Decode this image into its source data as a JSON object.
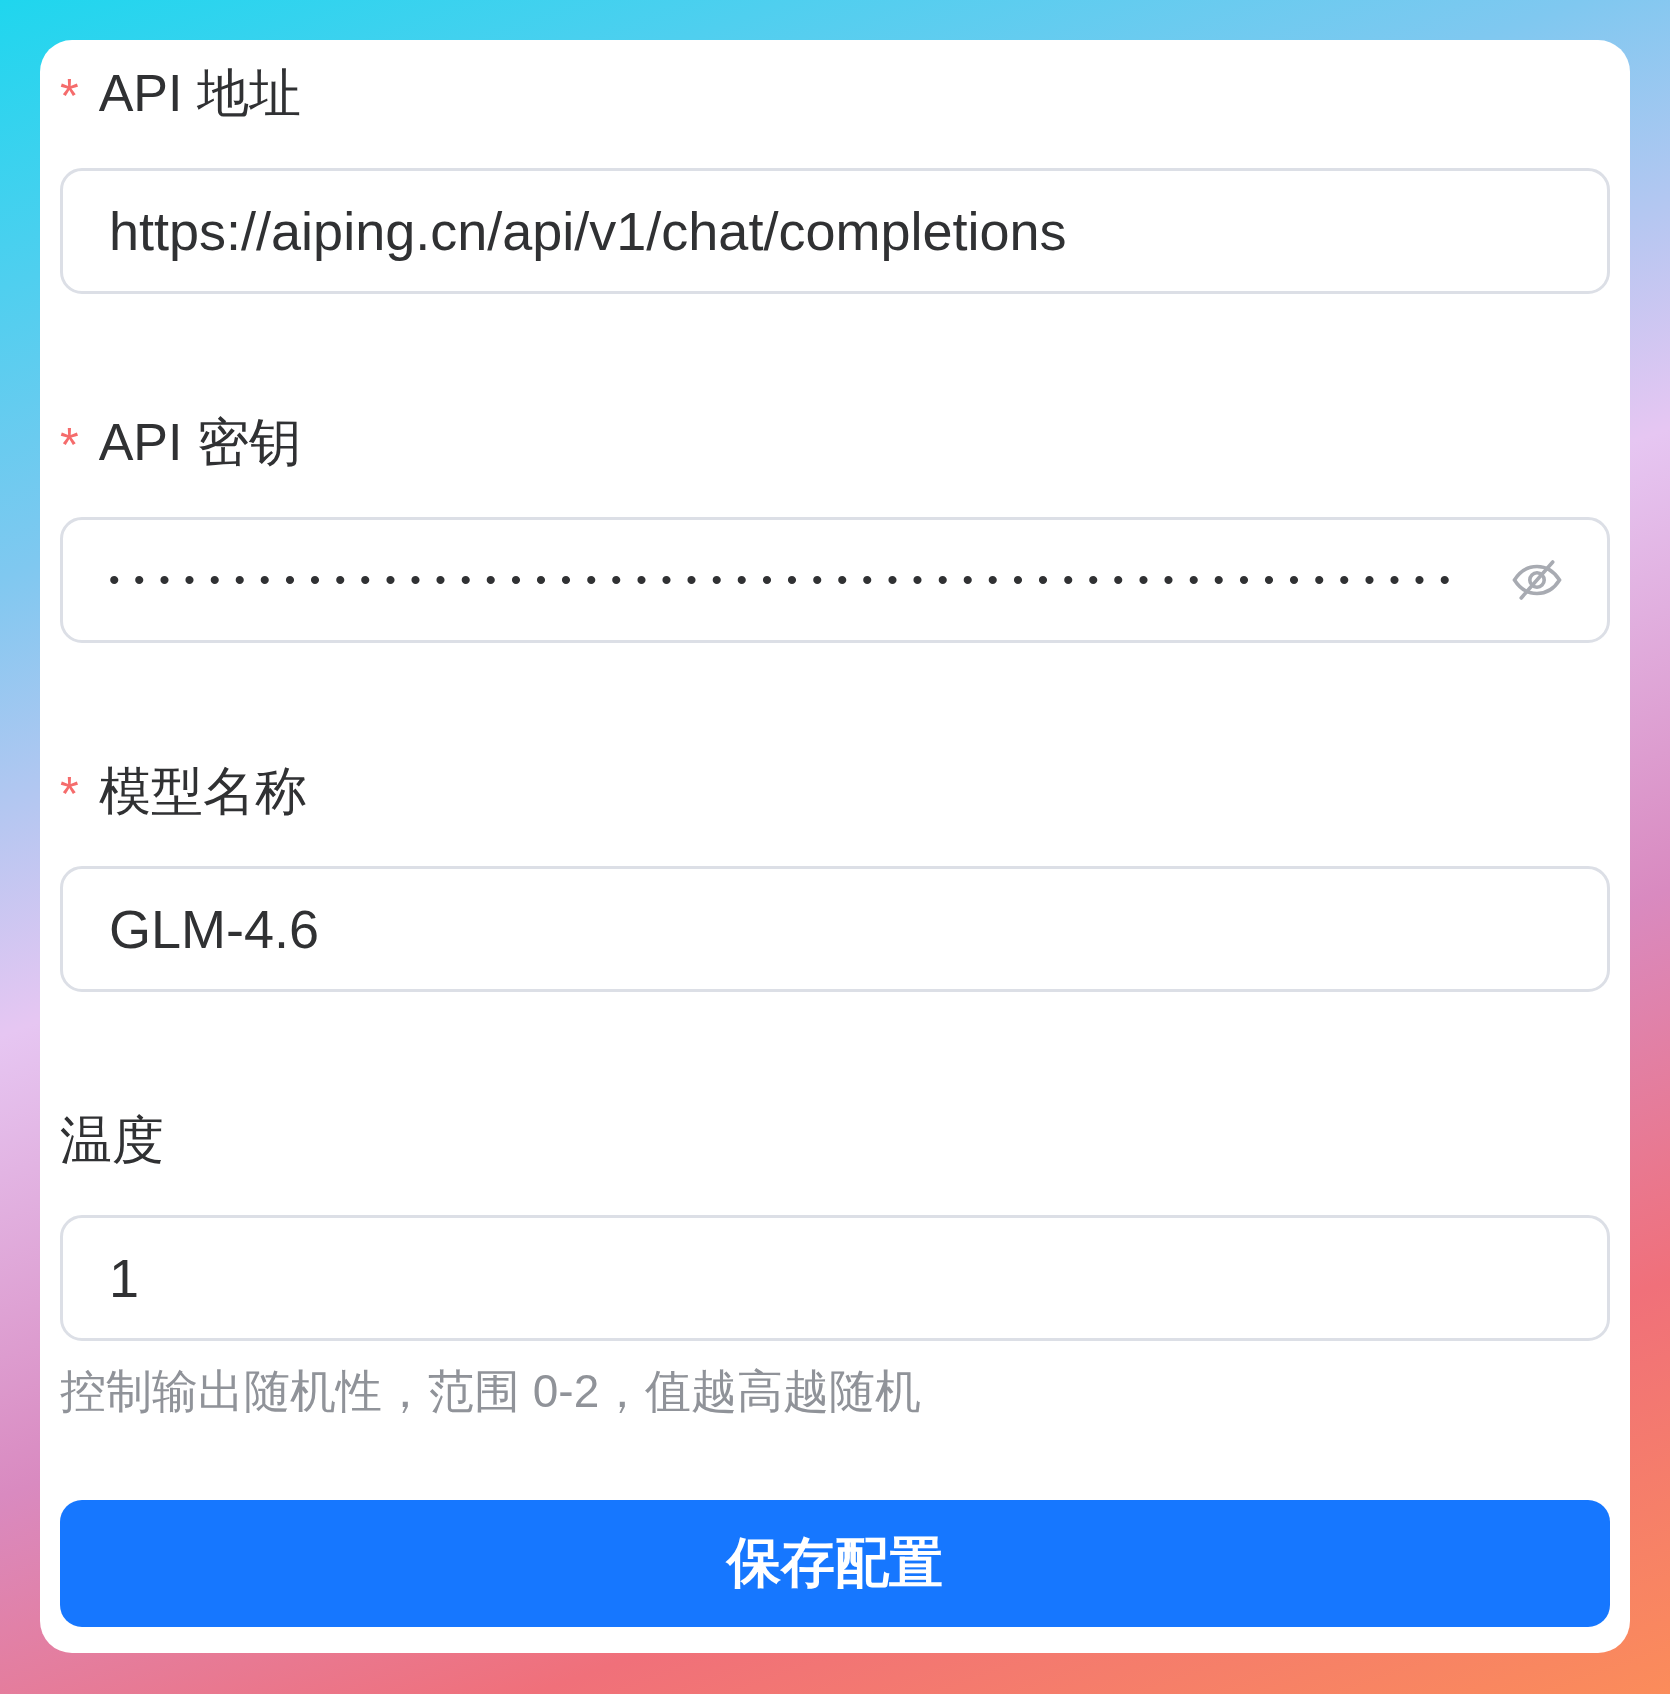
{
  "fields": [
    {
      "label": "API 地址",
      "required_mark": "*",
      "kind": "text",
      "value": "https://aiping.cn/api/v1/chat/completions"
    },
    {
      "label": "API 密钥",
      "required_mark": "*",
      "kind": "password",
      "value": "••••••••••••••••••••••••••••••••••••••••••••••••••••••"
    },
    {
      "label": "模型名称",
      "required_mark": "*",
      "kind": "text",
      "value": "GLM-4.6"
    },
    {
      "label": "温度",
      "kind": "text",
      "value": "1",
      "hint": "控制输出随机性，范围 0-2，值越高越随机"
    }
  ],
  "save_button": "保存配置"
}
